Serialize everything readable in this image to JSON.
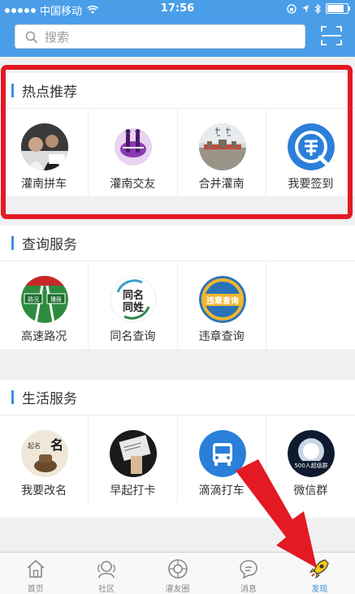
{
  "status_bar": {
    "carrier": "中国移动",
    "time": "17:56",
    "battery_level": 0.9
  },
  "search": {
    "placeholder": "搜索"
  },
  "sections": {
    "hot": {
      "title": "热点推荐",
      "items": [
        {
          "label": "灌南拼车",
          "icon": "carpool-photo"
        },
        {
          "label": "灌南交友",
          "icon": "dating-icon"
        },
        {
          "label": "合并灌南",
          "icon": "merge-guannan-photo"
        },
        {
          "label": "我要签到",
          "icon": "checkin-icon"
        }
      ]
    },
    "query": {
      "title": "查询服务",
      "items": [
        {
          "label": "高速路况",
          "icon": "highway-icon",
          "sign": [
            "路况",
            "播报"
          ]
        },
        {
          "label": "同名查询",
          "icon": "same-name-icon",
          "sign": [
            "同名",
            "同姓"
          ]
        },
        {
          "label": "违章查询",
          "icon": "violation-icon",
          "sign": [
            "违章查询"
          ]
        }
      ]
    },
    "life": {
      "title": "生活服务",
      "items": [
        {
          "label": "我要改名",
          "icon": "rename-icon",
          "sign": [
            "起名",
            "名"
          ]
        },
        {
          "label": "早起打卡",
          "icon": "early-checkin-icon"
        },
        {
          "label": "滴滴打车",
          "icon": "taxi-icon"
        },
        {
          "label": "微信群",
          "icon": "wechat-group-icon",
          "sign": [
            "500人超级群"
          ]
        }
      ]
    }
  },
  "tabs": [
    {
      "label": "首页",
      "icon": "home-icon"
    },
    {
      "label": "社区",
      "icon": "community-icon"
    },
    {
      "label": "灌友圈",
      "icon": "friends-circle-icon"
    },
    {
      "label": "消息",
      "icon": "message-icon"
    },
    {
      "label": "发现",
      "icon": "rocket-icon",
      "active": true
    }
  ],
  "colors": {
    "accent": "#4a9ee8",
    "highlight": "#e31923"
  }
}
